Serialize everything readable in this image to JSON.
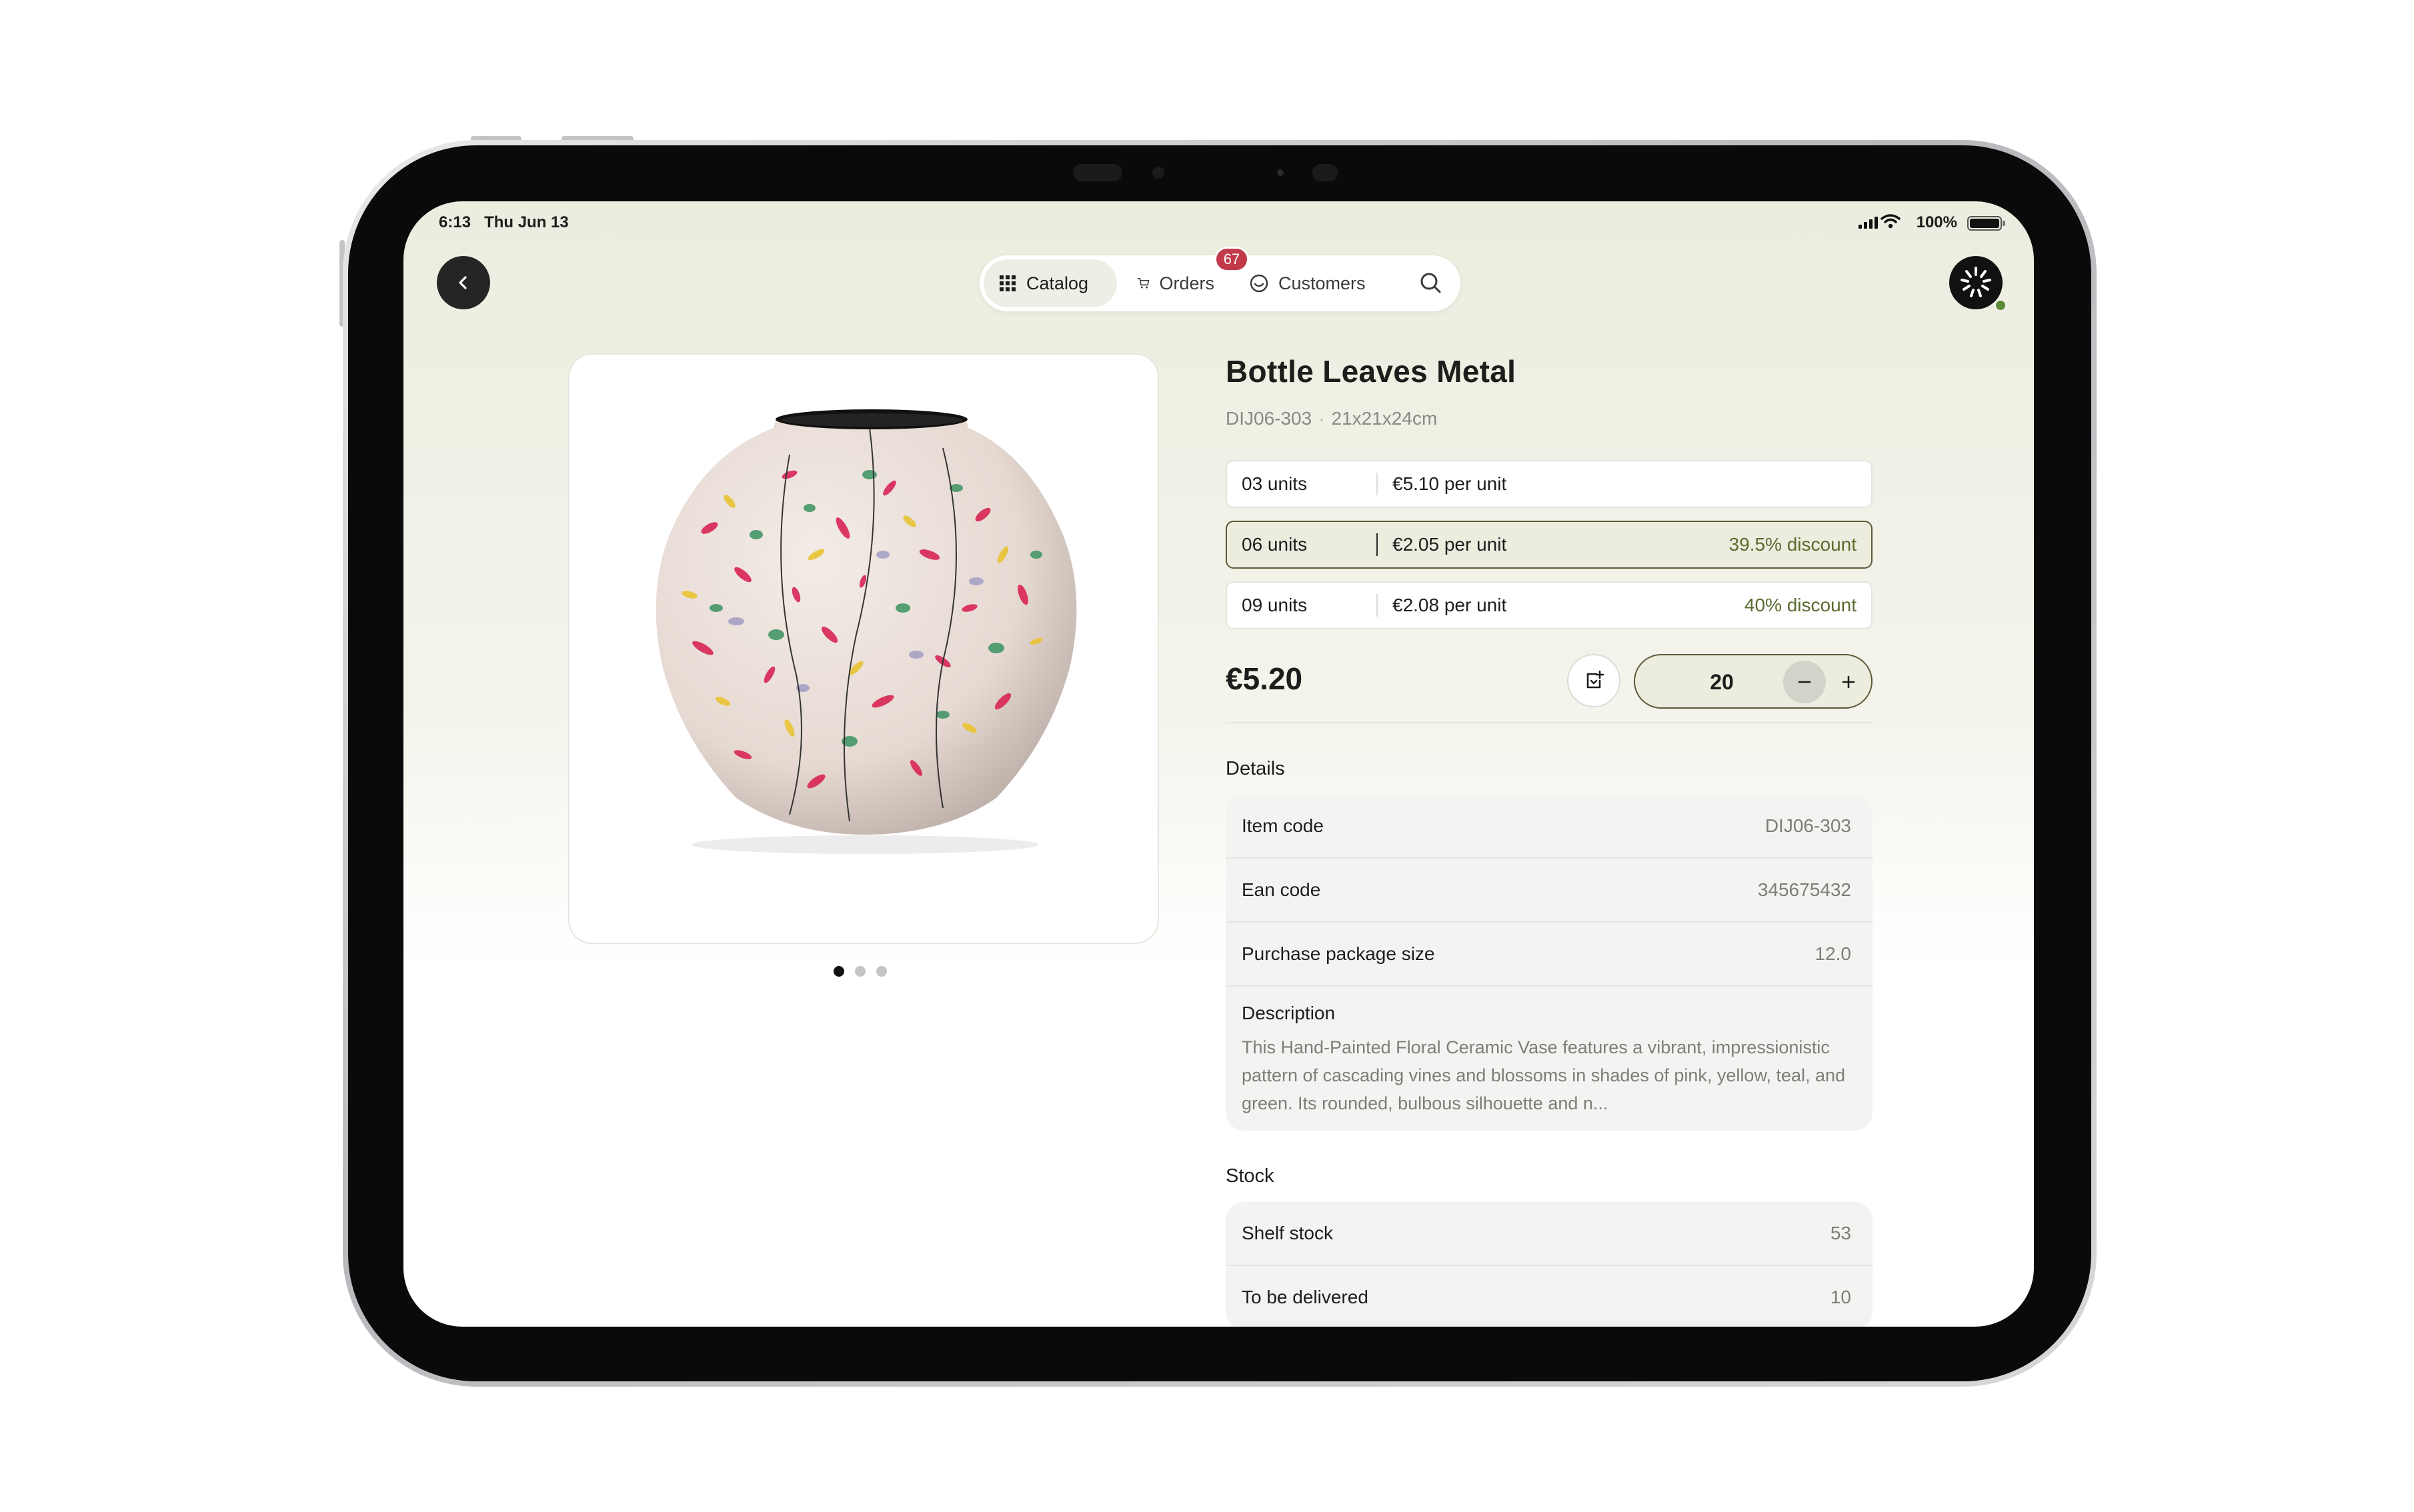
{
  "status_bar": {
    "time": "6:13",
    "date": "Thu Jun 13",
    "battery_percent": "100%",
    "battery_level": 1.0,
    "signal_bars": 4
  },
  "nav": {
    "tabs": [
      {
        "label": "Catalog",
        "icon": "grid-icon",
        "active": true
      },
      {
        "label": "Orders",
        "icon": "cart-icon",
        "active": false
      },
      {
        "label": "Customers",
        "icon": "smiley-icon",
        "active": false
      }
    ],
    "orders_badge": "67",
    "search_icon": "search-icon",
    "back_icon": "chevron-left-icon",
    "avatar_icon": "starburst-logo-icon",
    "avatar_status_color": "#5b8c3a"
  },
  "product": {
    "title": "Bottle Leaves Metal",
    "code": "DIJ06-303",
    "dimensions": "21x21x24cm",
    "image_carousel": {
      "total": 3,
      "active_index": 0
    },
    "tiers": [
      {
        "units": "03 units",
        "price": "€5.10 per unit",
        "discount": "",
        "selected": false
      },
      {
        "units": "06 units",
        "price": "€2.05 per unit",
        "discount": "39.5% discount",
        "selected": true
      },
      {
        "units": "09 units",
        "price": "€2.08 per unit",
        "discount": "40% discount",
        "selected": false
      }
    ],
    "price": "€5.20",
    "quantity": "20",
    "note_icon": "note-add-icon"
  },
  "details": {
    "label": "Details",
    "rows": [
      {
        "label": "Item code",
        "value": "DIJ06-303"
      },
      {
        "label": "Ean code",
        "value": "345675432"
      },
      {
        "label": "Purchase package size",
        "value": "12.0"
      }
    ],
    "description_label": "Description",
    "description_text": "This Hand-Painted Floral Ceramic Vase features a vibrant, impressionistic pattern of cascading vines and blossoms in shades of pink, yellow, teal, and green. Its rounded, bulbous silhouette and n..."
  },
  "stock": {
    "label": "Stock",
    "rows": [
      {
        "label": "Shelf stock",
        "value": "53"
      },
      {
        "label": "To be delivered",
        "value": "10"
      }
    ]
  },
  "colors": {
    "accent_dark": "#252525",
    "selected_fill": "#ececdf",
    "selected_border": "#5b5b3a",
    "discount_text": "#5a6b2e",
    "badge": "#c23a4a"
  }
}
